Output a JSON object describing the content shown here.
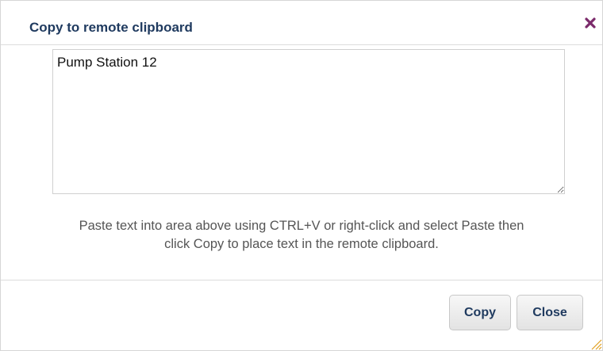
{
  "dialog": {
    "title": "Copy to remote clipboard",
    "close_icon": "close-x-icon",
    "textarea_value": "Pump Station 12",
    "instructions_line1": "Paste text into area above using CTRL+V or right-click and select Paste then",
    "instructions_line2": "click Copy to place text in the remote clipboard.",
    "copy_label": "Copy",
    "close_label": "Close"
  },
  "colors": {
    "title": "#1f3a5f",
    "close_icon": "#7b2a6b",
    "instructions": "#555555",
    "resize_grip": "#e0a020"
  }
}
